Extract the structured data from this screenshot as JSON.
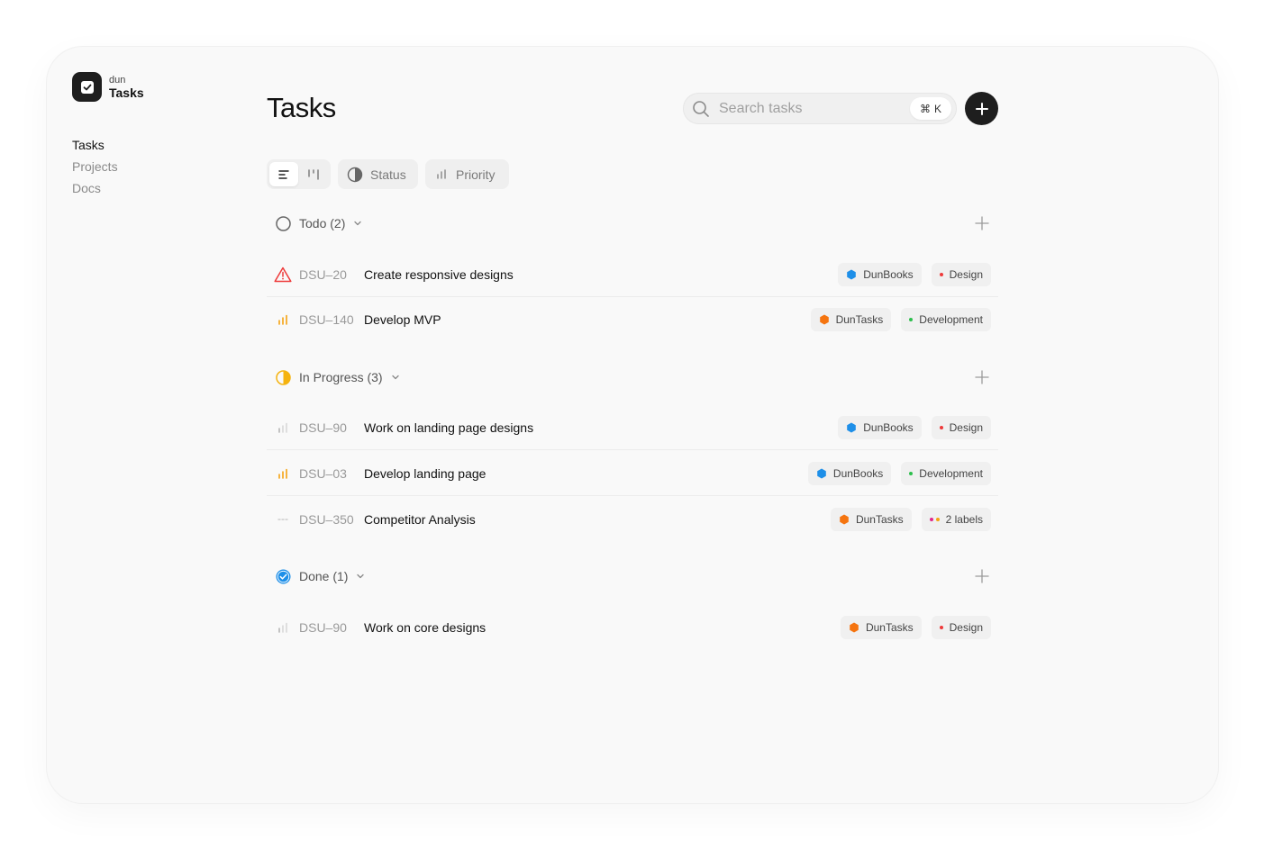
{
  "app": {
    "brand_small": "dun",
    "brand_name": "Tasks"
  },
  "sidebar": {
    "items": [
      {
        "label": "Tasks",
        "active": true
      },
      {
        "label": "Projects",
        "active": false
      },
      {
        "label": "Docs",
        "active": false
      }
    ]
  },
  "header": {
    "title": "Tasks",
    "search_placeholder": "Search tasks",
    "shortcut_symbol": "⌘",
    "shortcut_key": "K"
  },
  "toolbar": {
    "status_label": "Status",
    "priority_label": "Priority"
  },
  "groups": [
    {
      "label": "Todo (2)",
      "status": "todo",
      "tasks": [
        {
          "id": "DSU–20",
          "title": "Create responsive designs",
          "priority": "urgent",
          "project": "DunBooks",
          "project_color": "#1e8fe8",
          "label": "Design",
          "label_color": "#ee3a3a"
        },
        {
          "id": "DSU–140",
          "title": "Develop MVP",
          "priority": "high",
          "project": "DunTasks",
          "project_color": "#f5740f",
          "label": "Development",
          "label_color": "#2cbf4c"
        }
      ]
    },
    {
      "label": "In Progress (3)",
      "status": "in-progress",
      "tasks": [
        {
          "id": "DSU–90",
          "title": "Work on landing page designs",
          "priority": "low",
          "project": "DunBooks",
          "project_color": "#1e8fe8",
          "label": "Design",
          "label_color": "#ee3a3a"
        },
        {
          "id": "DSU–03",
          "title": "Develop landing page",
          "priority": "high",
          "project": "DunBooks",
          "project_color": "#1e8fe8",
          "label": "Development",
          "label_color": "#2cbf4c"
        },
        {
          "id": "DSU–350",
          "title": "Competitor Analysis",
          "priority": "none",
          "project": "DunTasks",
          "project_color": "#f5740f",
          "label": "2 labels",
          "label_colors": [
            "#e0288a",
            "#f5a312"
          ]
        }
      ]
    },
    {
      "label": "Done (1)",
      "status": "done",
      "tasks": [
        {
          "id": "DSU–90",
          "title": "Work on core designs",
          "priority": "low",
          "project": "DunTasks",
          "project_color": "#f5740f",
          "label": "Design",
          "label_color": "#ee3a3a"
        }
      ]
    }
  ]
}
